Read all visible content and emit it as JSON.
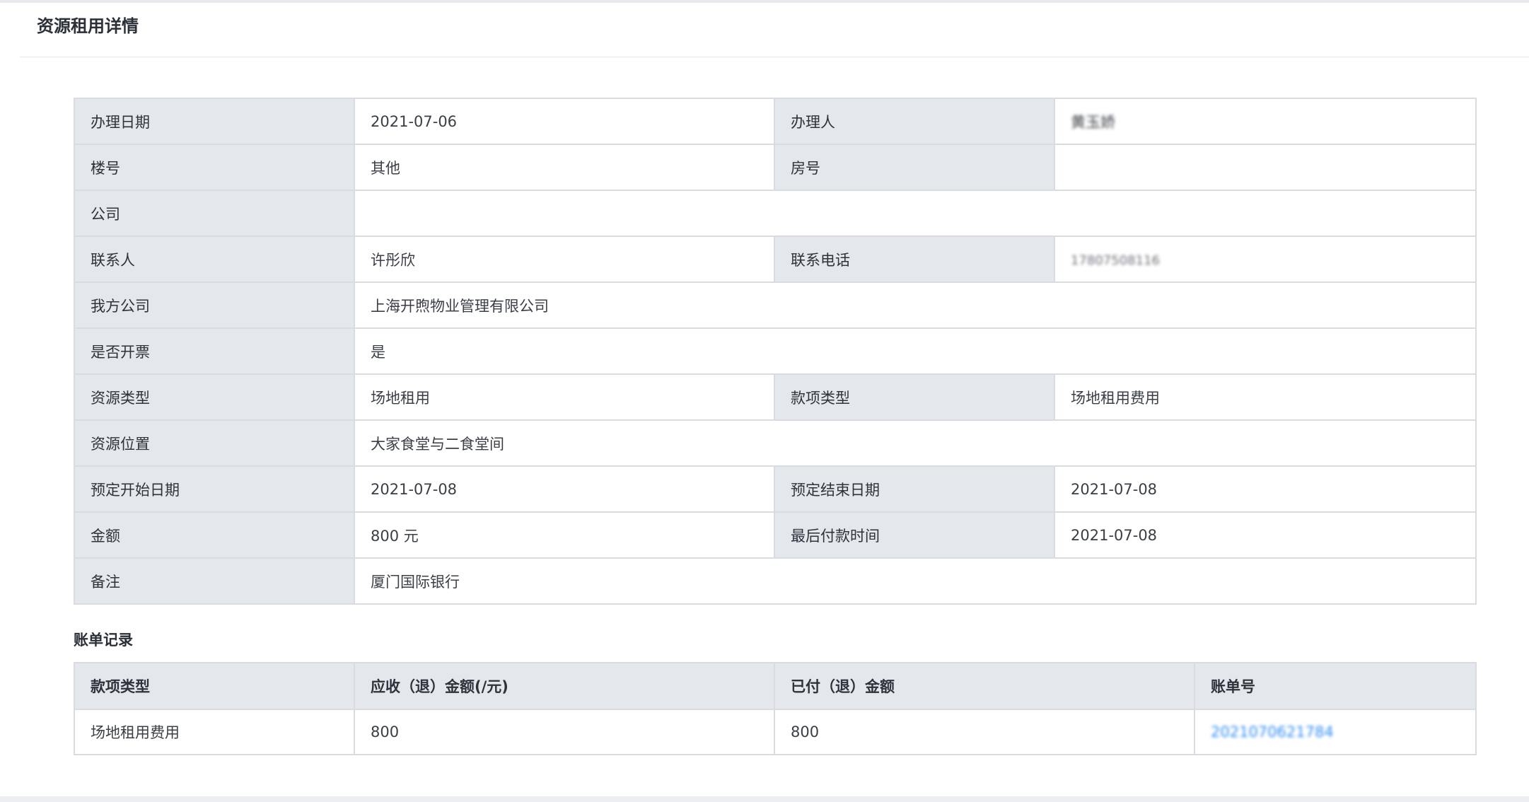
{
  "page": {
    "title": "资源租用详情"
  },
  "detail": {
    "handle_date_label": "办理日期",
    "handle_date": "2021-07-06",
    "handler_label": "办理人",
    "handler": "黄玉娇",
    "building_label": "楼号",
    "building": "其他",
    "room_label": "房号",
    "room": "",
    "company_label": "公司",
    "company": "",
    "contact_label": "联系人",
    "contact": "许彤欣",
    "phone_label": "联系电话",
    "phone": "17807508116",
    "our_company_label": "我方公司",
    "our_company": "上海开煦物业管理有限公司",
    "invoice_label": "是否开票",
    "invoice": "是",
    "resource_type_label": "资源类型",
    "resource_type": "场地租用",
    "fee_type_label": "款项类型",
    "fee_type": "场地租用费用",
    "location_label": "资源位置",
    "location": "大家食堂与二食堂间",
    "start_label": "预定开始日期",
    "start": "2021-07-08",
    "end_label": "预定结束日期",
    "end": "2021-07-08",
    "amount_label": "金额",
    "amount": "800 元",
    "last_pay_label": "最后付款时间",
    "last_pay": "2021-07-08",
    "remark_label": "备注",
    "remark": "厦门国际银行"
  },
  "bills": {
    "section_title": "账单记录",
    "columns": [
      "款项类型",
      "应收（退）金额(/元)",
      "已付（退）金额",
      "账单号"
    ],
    "rows": [
      [
        "场地租用费用",
        "800",
        "800",
        "2021070621784"
      ]
    ]
  }
}
